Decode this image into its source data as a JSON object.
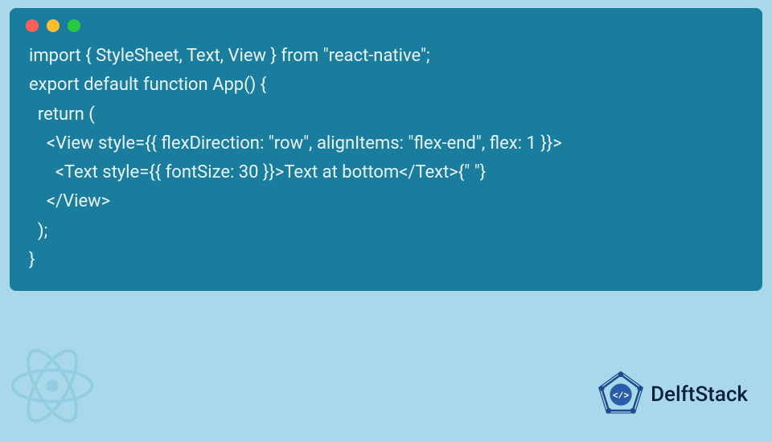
{
  "code": {
    "line1": "import { StyleSheet, Text, View } from \"react-native\";",
    "line2": "export default function App() {",
    "line3": "  return (",
    "line4": "    <View style={{ flexDirection: \"row\", alignItems: \"flex-end\", flex: 1 }}>",
    "line5": "      <Text style={{ fontSize: 30 }}>Text at bottom</Text>{\" \"}",
    "line6": "    </View>",
    "line7": "  );",
    "line8": "}"
  },
  "brand": {
    "name": "DelftStack"
  },
  "colors": {
    "background": "#a8d8ea",
    "window": "#1b7d9e",
    "text": "#e8f4f8",
    "brand": "#0a1e3d"
  }
}
